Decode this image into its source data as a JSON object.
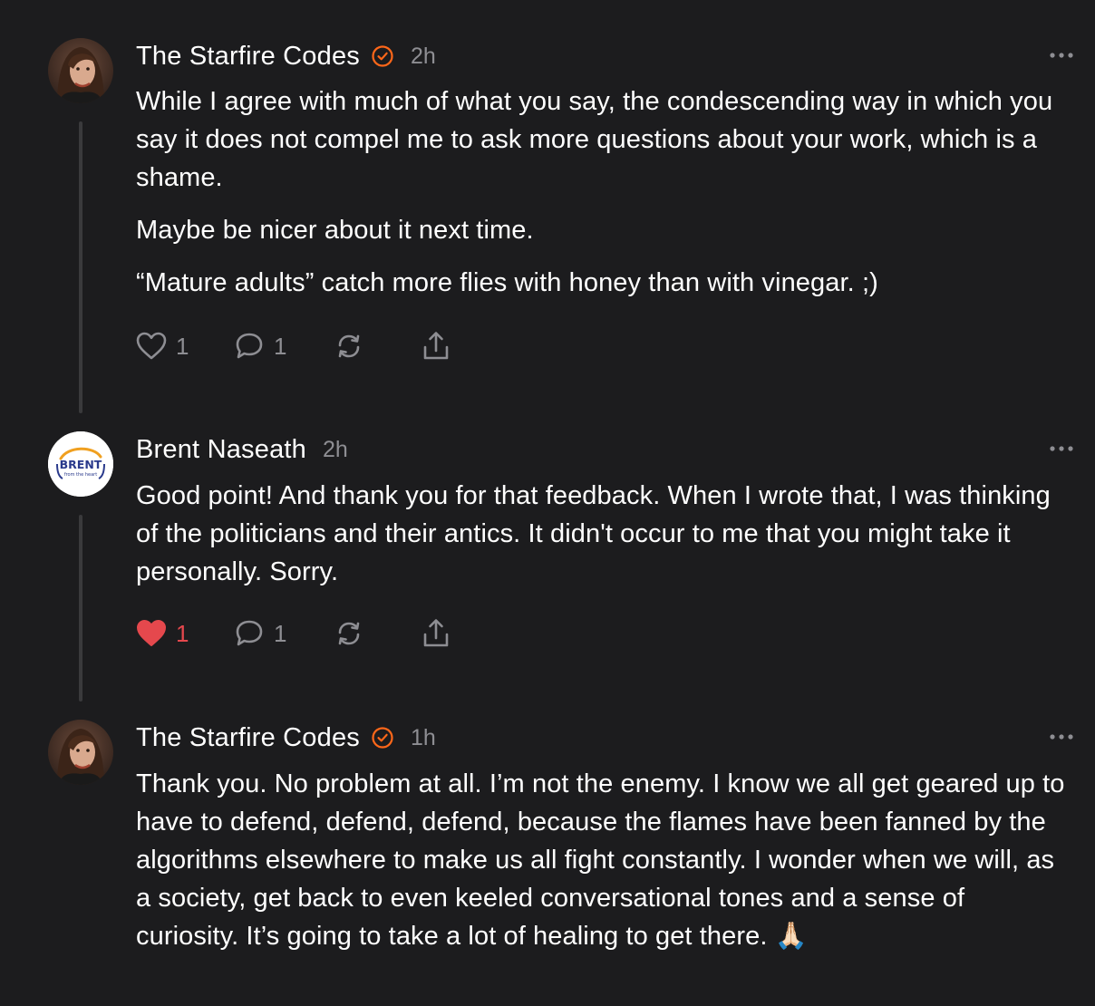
{
  "comments": [
    {
      "author": "The Starfire Codes",
      "verified": true,
      "time": "2h",
      "paragraphs": [
        "While I agree with much of what you say, the condescending way in which you say it does not compel me to ask more questions about your work, which is a shame.",
        "Maybe be nicer about it next time.",
        "“Mature adults” catch more flies with honey than with vinegar. ;)"
      ],
      "likes": "1",
      "replies": "1",
      "liked": false
    },
    {
      "author": "Brent Naseath",
      "verified": false,
      "time": "2h",
      "avatar_text": "BRENT",
      "avatar_subtext": "from the heart",
      "paragraphs": [
        "Good point! And thank you for that feedback. When I wrote that, I was thinking of the politicians and their antics. It didn't occur to me that you might take it personally. Sorry."
      ],
      "likes": "1",
      "replies": "1",
      "liked": true
    },
    {
      "author": "The Starfire Codes",
      "verified": true,
      "time": "1h",
      "paragraphs": [
        "Thank you. No problem at all. I’m not the enemy. I know we all get geared up to have to defend, defend, defend, because the flames have been fanned by the algorithms elsewhere to make us all fight constantly. I wonder when we will, as a society, get back to even keeled conversational tones and a sense of curiosity. It’s going to take a lot of healing to get there. 🙏🏻"
      ]
    }
  ],
  "colors": {
    "background": "#1c1c1e",
    "text": "#ffffff",
    "muted": "#8e8e93",
    "verified": "#ff6719",
    "liked": "#e5484d",
    "thread_line": "#3a3a3c"
  },
  "icons": [
    "verified-badge-icon",
    "more-icon",
    "heart-icon",
    "comment-icon",
    "restack-icon",
    "share-icon"
  ]
}
